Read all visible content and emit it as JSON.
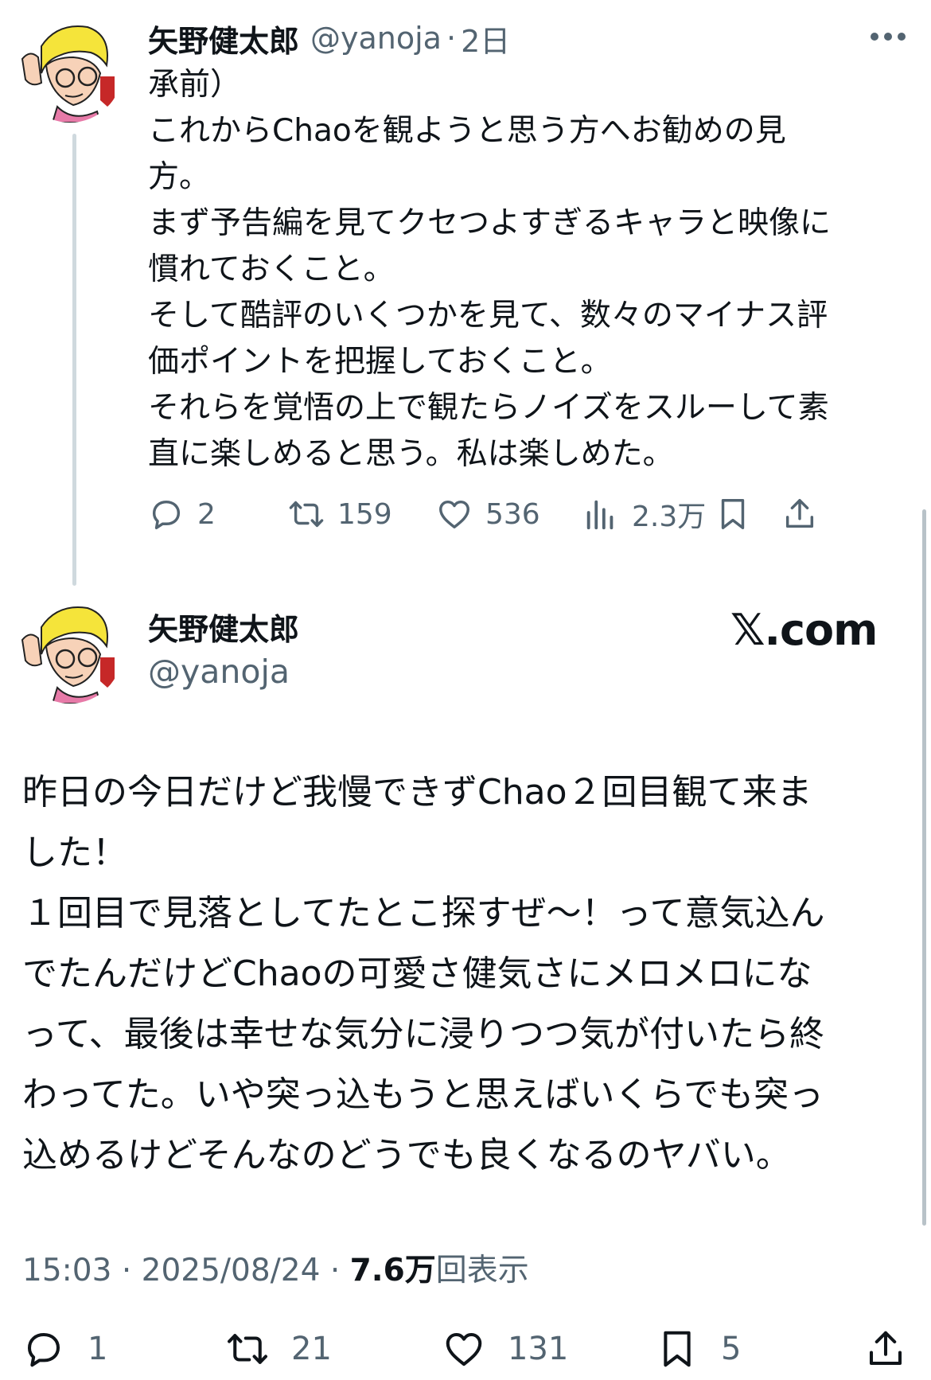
{
  "reply_tweet": {
    "author_name": "矢野健太郎",
    "author_handle": "@yanoja",
    "separator": "·",
    "time_ago": "2日",
    "text": "承前）\nこれからChaoを観ようと思う方へお勧めの見\n方。\nまず予告編を見てクセつよすぎるキャラと映像に\n慣れておくこと。\nそして酷評のいくつかを見て、数々のマイナス評\n価ポイントを把握しておくこと。\nそれらを覚悟の上で観たらノイズをスルーして素\n直に楽しめると思う。私は楽しめた。",
    "replies": "2",
    "reposts": "159",
    "likes": "536",
    "views": "2.3万"
  },
  "main_tweet": {
    "author_name": "矢野健太郎",
    "author_handle": "@yanoja",
    "brand": "𝕏.com",
    "text": "昨日の今日だけど我慢できずChao２回目観て来ま\nした！\n１回目で見落としてたとこ探すぜ〜！って意気込ん\nでたんだけどChaoの可愛さ健気さにメロメロにな\nって、最後は幸せな気分に浸りつつ気が付いたら終\nわってた。いや突っ込もうと思えばいくらでも突っ\n込めるけどそんなのどうでも良くなるのヤバい。",
    "time": "15:03",
    "separator": "·",
    "date": "2025/08/24",
    "views_number": "7.6万",
    "views_label": "回表示",
    "replies": "1",
    "reposts": "21",
    "likes": "131",
    "bookmarks": "5"
  },
  "icons": {
    "more": "more-dots-icon",
    "reply": "reply-bubble-icon",
    "repost": "repost-arrows-icon",
    "like": "heart-icon",
    "views": "bar-chart-icon",
    "bookmark": "bookmark-icon",
    "share": "share-upload-icon"
  },
  "colors": {
    "text": "#0f1419",
    "secondary": "#536471",
    "thread_line": "#cfd9de"
  }
}
